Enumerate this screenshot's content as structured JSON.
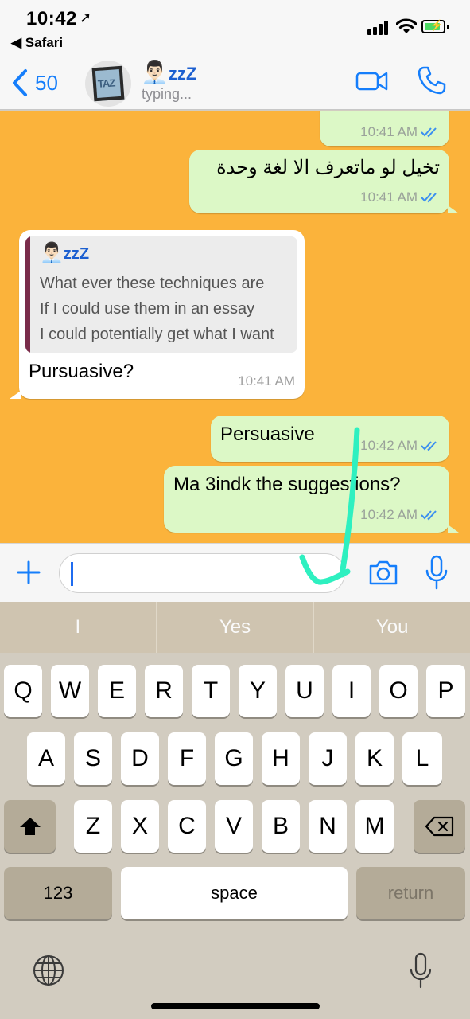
{
  "status_bar": {
    "time": "10:42",
    "back_app": "◀ Safari"
  },
  "header": {
    "back_count": "50",
    "avatar_label": "TAZ",
    "contact_emoji": "👨🏻‍💼",
    "contact_zzz": "zzZ",
    "status": "typing..."
  },
  "messages": [
    {
      "side": "out",
      "text": "",
      "time": "10:41 AM"
    },
    {
      "side": "out",
      "text": "تخيل لو ماتعرف الا لغة وحدة",
      "time": "10:41 AM"
    },
    {
      "side": "in",
      "quote": {
        "author_emoji": "👨🏻‍💼",
        "author_zzz": "zzZ",
        "lines": [
          "What ever these techniques are",
          "If I could use them in an essay",
          "I could potentially get what I want"
        ]
      },
      "text": "Pursuasive?",
      "time": "10:41 AM"
    },
    {
      "side": "out",
      "text": "Persuasive",
      "time": "10:42 AM"
    },
    {
      "side": "out",
      "text": "Ma 3indk the suggestions?",
      "time": "10:42 AM"
    }
  ],
  "input": {
    "placeholder": ""
  },
  "keyboard": {
    "predictions": [
      "I",
      "Yes",
      "You"
    ],
    "row1": [
      "Q",
      "W",
      "E",
      "R",
      "T",
      "Y",
      "U",
      "I",
      "O",
      "P"
    ],
    "row2": [
      "A",
      "S",
      "D",
      "F",
      "G",
      "H",
      "J",
      "K",
      "L"
    ],
    "row3": [
      "Z",
      "X",
      "C",
      "V",
      "B",
      "N",
      "M"
    ],
    "numbers_label": "123",
    "space_label": "space",
    "return_label": "return"
  },
  "colors": {
    "chat_background": "#fbb33b",
    "outgoing_bubble": "#dcf8c6",
    "accent": "#157efb",
    "annotation_arrow": "#2ef0c0"
  }
}
